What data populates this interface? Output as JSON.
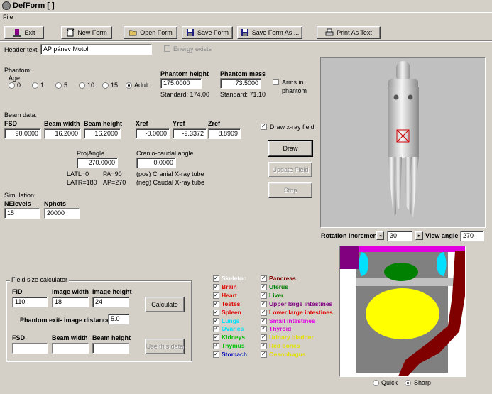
{
  "window": {
    "title": "DefForm  [  ]"
  },
  "menu": {
    "file": "File"
  },
  "toolbar": {
    "exit": "Exit",
    "new_form": "New Form",
    "open_form": "Open Form",
    "save_form": "Save Form",
    "save_form_as": "Save Form As ...",
    "print_as_text": "Print As Text"
  },
  "header": {
    "label": "Header text",
    "value": "AP pánev Motol",
    "energy_label": "Energy exists"
  },
  "phantom": {
    "label": "Phantom:",
    "age_label": "Age:",
    "ages": [
      "0",
      "1",
      "5",
      "10",
      "15",
      "Adult"
    ],
    "height_label": "Phantom height",
    "height_value": "175.0000",
    "height_std": "Standard: 174.00",
    "mass_label": "Phantom mass",
    "mass_value": "73.5000",
    "mass_std": "Standard: 71.10",
    "arms_label_1": "Arms in",
    "arms_label_2": "phantom"
  },
  "beam": {
    "label": "Beam data:",
    "fsd_label": "FSD",
    "fsd": "90.0000",
    "width_label": "Beam width",
    "width": "16.2000",
    "height_label": "Beam height",
    "height": "16.2000",
    "xref_label": "Xref",
    "xref": "-0.0000",
    "yref_label": "Yref",
    "yref": "-9.3372",
    "zref_label": "Zref",
    "zref": "8.8909",
    "draw_field_label": "Draw x-ray field",
    "projangle_label": "ProjAngle",
    "projangle": "270.0000",
    "cranio_label": "Cranio-caudal angle",
    "cranio": "0.0000",
    "latl": "LATL=0",
    "pa": "PA=90",
    "latr": "LATR=180",
    "ap": "AP=270",
    "pos_note": "(pos) Cranial X-ray tube",
    "neg_note": "(neg) Caudal X-ray tube"
  },
  "actions": {
    "draw": "Draw",
    "update_field": "Update Field",
    "stop": "Stop"
  },
  "simulation": {
    "label": "Simulation:",
    "nlevels_label": "NElevels",
    "nlevels": "15",
    "nphots_label": "Nphots",
    "nphots": "20000"
  },
  "view": {
    "rotation_label": "Rotation increment",
    "rotation_value": "30",
    "angle_label": "View angle",
    "angle_value": "270",
    "quick": "Quick",
    "sharp": "Sharp"
  },
  "field_calc": {
    "title": "Field size calculator",
    "fid_label": "FID",
    "fid": "110",
    "img_width_label": "Image width",
    "img_width": "18",
    "img_height_label": "Image height",
    "img_height": "24",
    "exit_label": "Phantom exit- image distance:",
    "exit_value": "5.0",
    "calculate": "Calculate",
    "fsd_label": "FSD",
    "beam_width_label": "Beam width",
    "beam_height_label": "Beam height",
    "use_data": "Use this data"
  },
  "organs_col1": [
    {
      "name": "Skeleton",
      "color": "#ffffff"
    },
    {
      "name": "Brain",
      "color": "#e00000"
    },
    {
      "name": "Heart",
      "color": "#e00000"
    },
    {
      "name": "Testes",
      "color": "#e00000"
    },
    {
      "name": "Spleen",
      "color": "#e00000"
    },
    {
      "name": "Lungs",
      "color": "#00e0ff"
    },
    {
      "name": "Ovaries",
      "color": "#00e0ff"
    },
    {
      "name": "Kidneys",
      "color": "#00c000"
    },
    {
      "name": "Thymus",
      "color": "#00c000"
    },
    {
      "name": "Stomach",
      "color": "#0000c0"
    }
  ],
  "organs_col2": [
    {
      "name": "Pancreas",
      "color": "#800000"
    },
    {
      "name": "Uterus",
      "color": "#008000"
    },
    {
      "name": "Liver",
      "color": "#008000"
    },
    {
      "name": "Upper large intestines",
      "color": "#800080"
    },
    {
      "name": "Lower large intestines",
      "color": "#e00000"
    },
    {
      "name": "Small intestines",
      "color": "#e000e0"
    },
    {
      "name": "Thyroid",
      "color": "#e000e0"
    },
    {
      "name": "Urinary bladder",
      "color": "#e0e000"
    },
    {
      "name": "Red bones",
      "color": "#e0e000"
    },
    {
      "name": "Oesophagus",
      "color": "#e0e000"
    }
  ]
}
